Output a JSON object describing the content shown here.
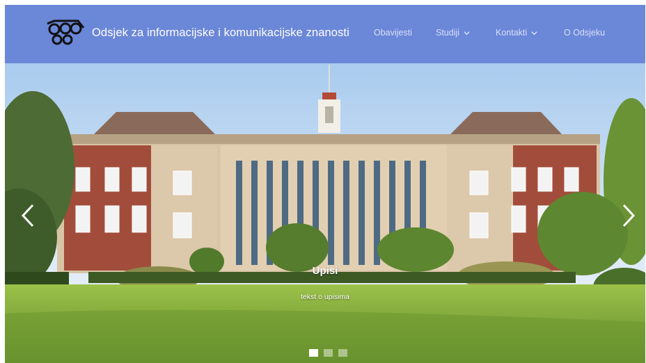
{
  "header": {
    "title": "Odsjek za informacijske i komunikacijske znanosti",
    "nav": [
      {
        "label": "Obavijesti",
        "dropdown": false
      },
      {
        "label": "Studiji",
        "dropdown": true
      },
      {
        "label": "Kontakti",
        "dropdown": true
      },
      {
        "label": "O Odsjeku",
        "dropdown": false
      }
    ]
  },
  "carousel": {
    "caption_title": "Upisi",
    "caption_text": "tekst o upisima",
    "slide_count": 3,
    "active_index": 0
  },
  "colors": {
    "navbar": "#6b87d8",
    "nav_text": "#d8e0f6",
    "brick": "#9a4b3a",
    "stone": "#d8c3a6",
    "lawn": "#8fb63f",
    "sky": "#cfe3f6"
  }
}
